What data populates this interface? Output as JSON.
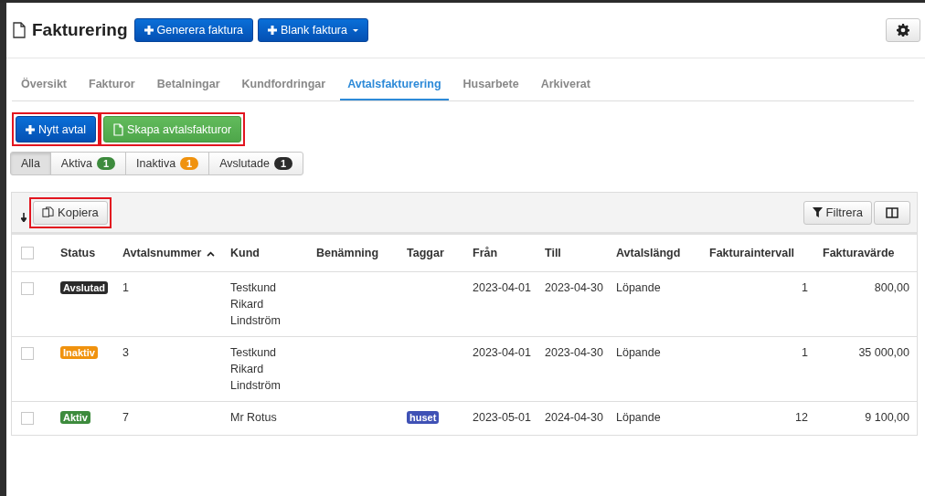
{
  "header": {
    "title": "Fakturering",
    "buttons": [
      {
        "label": "Generera faktura",
        "dropdown": false
      },
      {
        "label": "Blank faktura",
        "dropdown": true
      }
    ]
  },
  "tabs": [
    {
      "label": "Översikt",
      "selected": false
    },
    {
      "label": "Fakturor",
      "selected": false
    },
    {
      "label": "Betalningar",
      "selected": false
    },
    {
      "label": "Kundfordringar",
      "selected": false
    },
    {
      "label": "Avtalsfakturering",
      "selected": true
    },
    {
      "label": "Husarbete",
      "selected": false
    },
    {
      "label": "Arkiverat",
      "selected": false
    }
  ],
  "actions": [
    {
      "label": "Nytt avtal",
      "kind": "primary",
      "highlighted": true
    },
    {
      "label": "Skapa avtalsfakturor",
      "kind": "success",
      "highlighted": true
    }
  ],
  "filters": [
    {
      "label": "Alla",
      "selected": true
    },
    {
      "label": "Aktiva",
      "count": "1",
      "color": "#3d8b3d",
      "selected": false
    },
    {
      "label": "Inaktiva",
      "count": "1",
      "color": "#f0920e",
      "selected": false
    },
    {
      "label": "Avslutade",
      "count": "1",
      "color": "#2b2b2b",
      "selected": false
    }
  ],
  "toolbar": {
    "copy": {
      "label": "Kopiera",
      "highlighted": true
    },
    "filter": "Filtrera"
  },
  "table": {
    "select_all_checked": false,
    "columns": [
      {
        "label": "Status",
        "sorted": false
      },
      {
        "label": "Avtalsnummer",
        "sorted": true
      },
      {
        "label": "Kund",
        "sorted": false
      },
      {
        "label": "Benämning",
        "sorted": false
      },
      {
        "label": "Taggar",
        "sorted": false
      },
      {
        "label": "Från",
        "sorted": false
      },
      {
        "label": "Till",
        "sorted": false
      },
      {
        "label": "Avtalslängd",
        "sorted": false
      },
      {
        "label": "Fakturaintervall",
        "sorted": false
      },
      {
        "label": "Fakturavärde",
        "sorted": false
      }
    ],
    "rows": [
      {
        "checked": false,
        "status": {
          "label": "Avslutad",
          "color": "#2b2b2b"
        },
        "number": "1",
        "customer": "Testkund Rikard Lindström",
        "tag": null,
        "from": "2023-04-01",
        "to": "2023-04-30",
        "length": "Löpande",
        "interval": "1",
        "value": "800,00"
      },
      {
        "checked": false,
        "status": {
          "label": "Inaktiv",
          "color": "#f0920e"
        },
        "number": "3",
        "customer": "Testkund Rikard Lindström",
        "tag": null,
        "from": "2023-04-01",
        "to": "2023-04-30",
        "length": "Löpande",
        "interval": "1",
        "value": "35 000,00"
      },
      {
        "checked": false,
        "status": {
          "label": "Aktiv",
          "color": "#3d8b3d"
        },
        "number": "7",
        "customer": "Mr Rotus",
        "tag": {
          "label": "huset",
          "color": "#3f51b5"
        },
        "from": "2023-05-01",
        "to": "2024-04-30",
        "length": "Löpande",
        "interval": "12",
        "value": "9 100,00"
      }
    ]
  }
}
